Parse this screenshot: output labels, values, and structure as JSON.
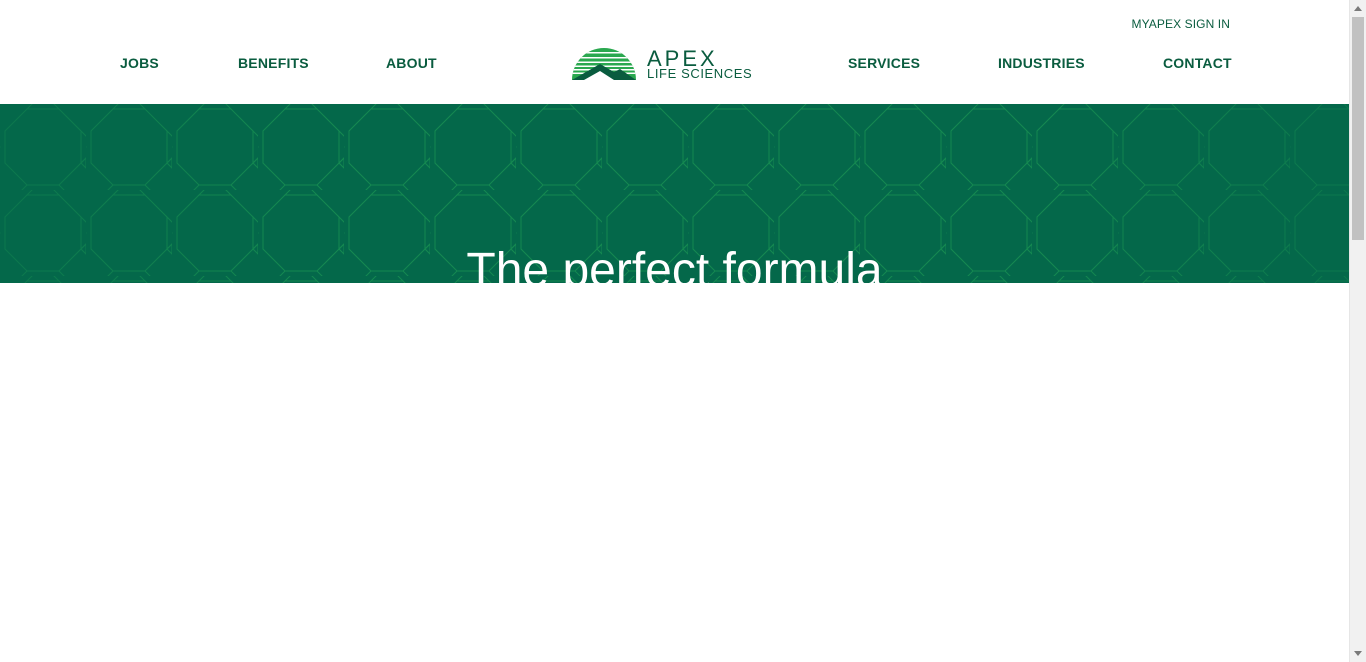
{
  "header": {
    "myapex_link": "MYAPEX SIGN IN",
    "nav_left": [
      "JOBS",
      "BENEFITS",
      "ABOUT"
    ],
    "nav_right": [
      "SERVICES",
      "INDUSTRIES",
      "CONTACT"
    ],
    "logo": {
      "word": "APEX",
      "sub": "LIFE SCIENCES"
    }
  },
  "hero": {
    "title": "The perfect formula"
  },
  "colors": {
    "brand_green": "#0a5c3f",
    "hero_green": "#04684a",
    "logo_light_green": "#2aa84f",
    "pattern_line": "#1d8f4f"
  },
  "icons": [
    "apex-logo-icon",
    "scroll-up-arrow-icon",
    "scroll-down-arrow-icon"
  ]
}
